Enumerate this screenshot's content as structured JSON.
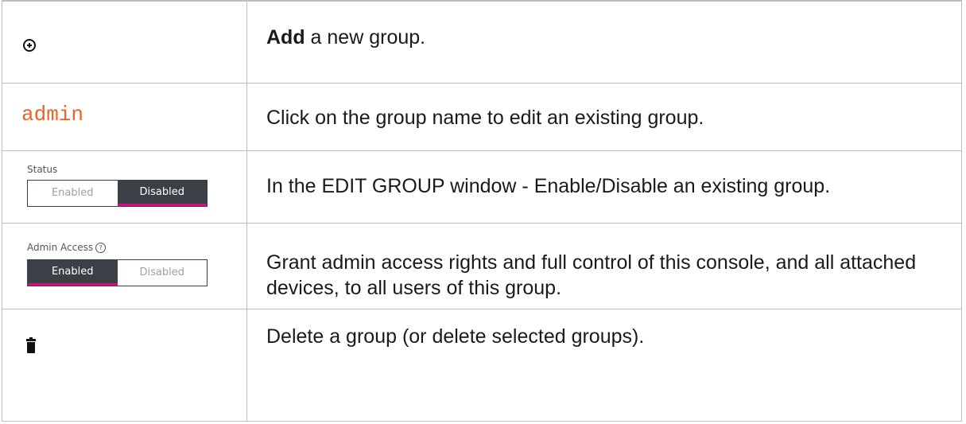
{
  "rows": [
    {
      "icon": "add-circle-icon",
      "desc_bold": "Add",
      "desc_rest": " a new group."
    },
    {
      "link_text": "admin",
      "link_color": "#e8652a",
      "desc": "Click on the group name to edit an existing group."
    },
    {
      "control_label": "Status",
      "options": [
        "Enabled",
        "Disabled"
      ],
      "selected": "Disabled",
      "desc": "In the EDIT GROUP window - Enable/Disable an existing group."
    },
    {
      "control_label": "Admin Access",
      "help_icon": "question-circle-icon",
      "help_glyph": "?",
      "options": [
        "Enabled",
        "Disabled"
      ],
      "selected": "Enabled",
      "desc": "Grant admin access rights and full control of this console, and all attached devices, to all users of this group."
    },
    {
      "icon": "trash-icon",
      "desc": "Delete a group (or delete selected groups)."
    }
  ],
  "colors": {
    "toggle_active_bg": "#3b4046",
    "toggle_active_underline": "#c2187a",
    "toggle_inactive_text": "#9aa0a6",
    "border": "#bdbdbd"
  }
}
